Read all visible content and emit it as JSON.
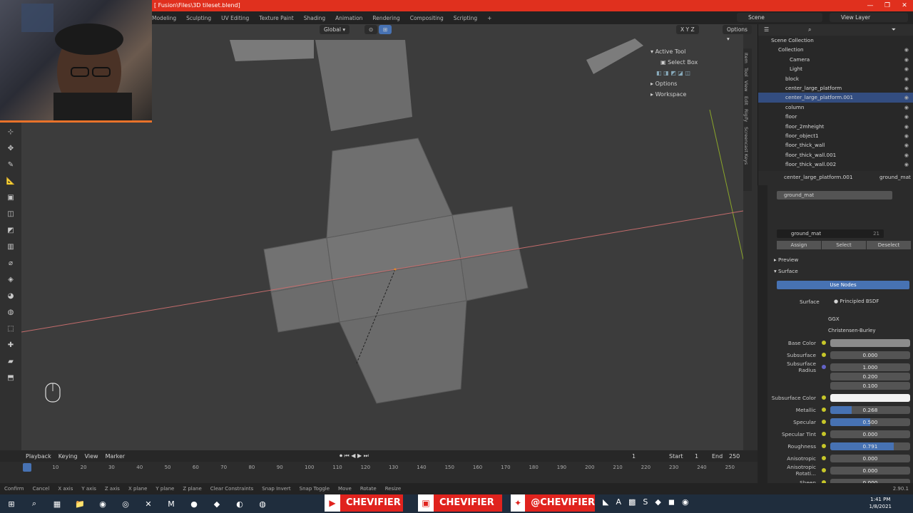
{
  "titlebar": {
    "file": "[ Fusion\\Files\\3D tileset.blend]"
  },
  "workspace_tabs": [
    "Modeling",
    "Sculpting",
    "UV Editing",
    "Texture Paint",
    "Shading",
    "Animation",
    "Rendering",
    "Compositing",
    "Scripting",
    "+"
  ],
  "scene": "Scene",
  "view_layer": "View Layer",
  "viewport": {
    "orientation": "Global",
    "options_label": "Options"
  },
  "npanel": {
    "active_tool": "Active Tool",
    "select_box": "Select Box",
    "options": "Options",
    "workspace": "Workspace",
    "tabs": [
      "Item",
      "Tool",
      "View",
      "Edit",
      "Rigify",
      "Screencast Keys"
    ]
  },
  "outliner": {
    "rows": [
      {
        "label": "Scene Collection",
        "selected": false
      },
      {
        "label": "Collection",
        "selected": false
      },
      {
        "label": "Camera",
        "selected": false
      },
      {
        "label": "Light",
        "selected": false
      },
      {
        "label": "block",
        "selected": false
      },
      {
        "label": "center_large_platform",
        "selected": false
      },
      {
        "label": "center_large_platform.001",
        "selected": true
      },
      {
        "label": "column",
        "selected": false
      },
      {
        "label": "floor",
        "selected": false
      },
      {
        "label": "floor_2mheight",
        "selected": false
      },
      {
        "label": "floor_object1",
        "selected": false
      },
      {
        "label": "floor_thick_wall",
        "selected": false
      },
      {
        "label": "floor_thick_wall.001",
        "selected": false
      },
      {
        "label": "floor_thick_wall.002",
        "selected": false
      }
    ]
  },
  "properties": {
    "object": "center_large_platform.001",
    "material_tab": "ground_mat",
    "slot": "ground_mat",
    "material_name": "ground_mat",
    "user_count": "21",
    "assign": "Assign",
    "select": "Select",
    "deselect": "Deselect",
    "preview": "Preview",
    "surface_section": "Surface",
    "use_nodes": "Use Nodes",
    "surface_label": "Surface",
    "surface_value": "Principled BSDF",
    "distribution": "GGX",
    "subsurface_method": "Christensen-Burley",
    "rows": [
      {
        "label": "Base Color",
        "value": "",
        "fill": 0,
        "kind": "color-gray"
      },
      {
        "label": "Subsurface",
        "value": "0.000",
        "fill": 0,
        "kind": "num"
      },
      {
        "label": "Subsurface Radius",
        "value": "1.000",
        "fill": 0,
        "kind": "num"
      },
      {
        "label": "",
        "value": "0.200",
        "fill": 0,
        "kind": "num"
      },
      {
        "label": "",
        "value": "0.100",
        "fill": 0,
        "kind": "num"
      },
      {
        "label": "Subsurface Color",
        "value": "",
        "fill": 0,
        "kind": "color-white"
      },
      {
        "label": "Metallic",
        "value": "0.268",
        "fill": 0.268,
        "kind": "num"
      },
      {
        "label": "Specular",
        "value": "0.500",
        "fill": 0.5,
        "kind": "num"
      },
      {
        "label": "Specular Tint",
        "value": "0.000",
        "fill": 0,
        "kind": "num"
      },
      {
        "label": "Roughness",
        "value": "0.791",
        "fill": 0.791,
        "kind": "num"
      },
      {
        "label": "Anisotropic",
        "value": "0.000",
        "fill": 0,
        "kind": "num"
      },
      {
        "label": "Anisotropic Rotati...",
        "value": "0.000",
        "fill": 0,
        "kind": "num"
      },
      {
        "label": "Sheen",
        "value": "0.000",
        "fill": 0,
        "kind": "num"
      }
    ]
  },
  "timeline": {
    "playback": "Playback",
    "keying": "Keying",
    "view": "View",
    "marker": "Marker",
    "current_frame": "1",
    "start_label": "Start",
    "start": "1",
    "end_label": "End",
    "end": "250",
    "ticks": [
      "1",
      "10",
      "20",
      "30",
      "40",
      "50",
      "60",
      "70",
      "80",
      "90",
      "100",
      "110",
      "120",
      "130",
      "140",
      "150",
      "160",
      "170",
      "180",
      "190",
      "200",
      "210",
      "220",
      "230",
      "240",
      "250"
    ]
  },
  "statusbar": [
    "Confirm",
    "Cancel",
    "X axis",
    "Y axis",
    "Z axis",
    "X plane",
    "Y plane",
    "Z plane",
    "Clear Constraints",
    "Snap Invert",
    "Snap Toggle",
    "Move",
    "Rotate",
    "Resize"
  ],
  "version": "2.90.1",
  "social": {
    "youtube": "CHEVIFIER",
    "twitch": "CHEVIFIER",
    "twitter": "@CHEVIFIER"
  },
  "clock": {
    "time": "1:41 PM",
    "date": "1/8/2021"
  },
  "colors": {
    "accent": "#4772b3",
    "title_bar": "#e0301e",
    "social_red": "#e0231e"
  }
}
